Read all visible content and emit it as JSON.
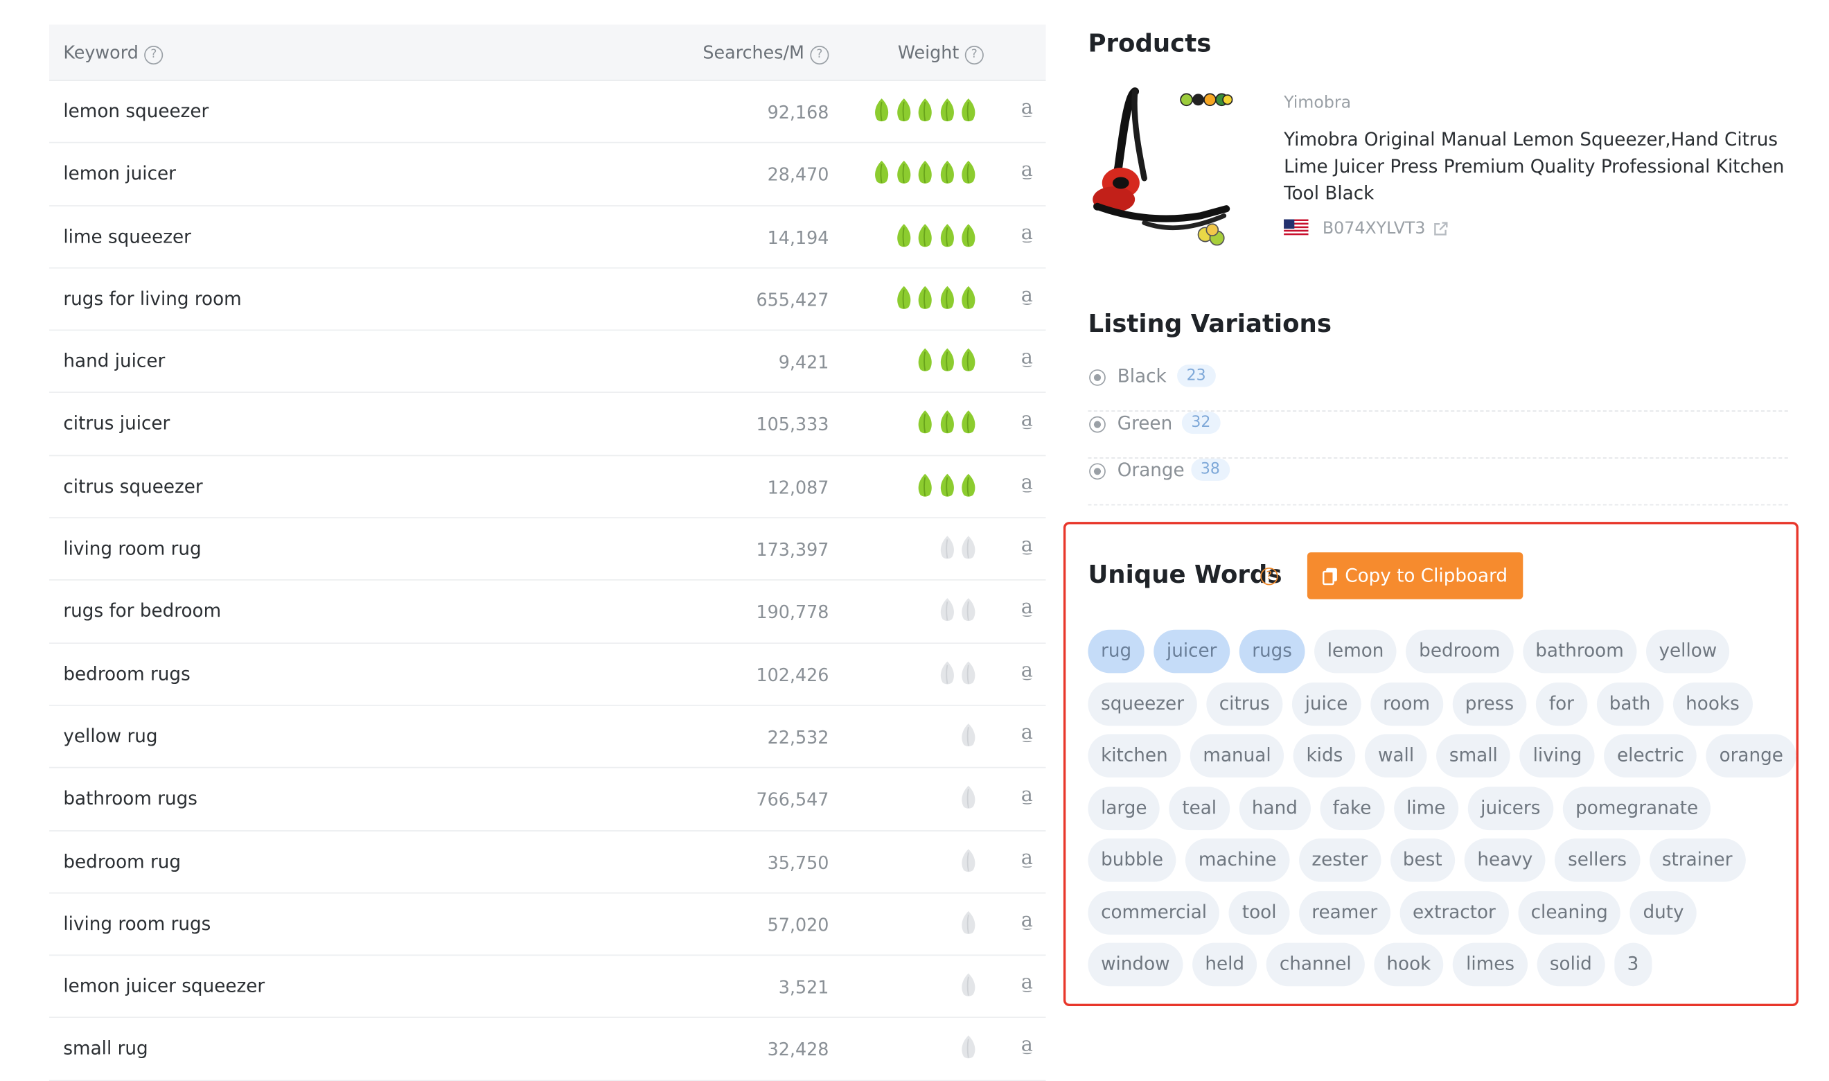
{
  "keyword_table": {
    "headers": {
      "keyword": "Keyword",
      "searches": "Searches/M",
      "weight": "Weight"
    },
    "rows": [
      {
        "keyword": "lemon squeezer",
        "searches": "92,168",
        "weight": 5,
        "weight_level": "high"
      },
      {
        "keyword": "lemon juicer",
        "searches": "28,470",
        "weight": 5,
        "weight_level": "high"
      },
      {
        "keyword": "lime squeezer",
        "searches": "14,194",
        "weight": 4,
        "weight_level": "high"
      },
      {
        "keyword": "rugs for living room",
        "searches": "655,427",
        "weight": 4,
        "weight_level": "high"
      },
      {
        "keyword": "hand juicer",
        "searches": "9,421",
        "weight": 3,
        "weight_level": "high"
      },
      {
        "keyword": "citrus juicer",
        "searches": "105,333",
        "weight": 3,
        "weight_level": "high"
      },
      {
        "keyword": "citrus squeezer",
        "searches": "12,087",
        "weight": 3,
        "weight_level": "high"
      },
      {
        "keyword": "living room rug",
        "searches": "173,397",
        "weight": 2,
        "weight_level": "low"
      },
      {
        "keyword": "rugs for bedroom",
        "searches": "190,778",
        "weight": 2,
        "weight_level": "low"
      },
      {
        "keyword": "bedroom rugs",
        "searches": "102,426",
        "weight": 2,
        "weight_level": "low"
      },
      {
        "keyword": "yellow rug",
        "searches": "22,532",
        "weight": 1,
        "weight_level": "low"
      },
      {
        "keyword": "bathroom rugs",
        "searches": "766,547",
        "weight": 1,
        "weight_level": "low"
      },
      {
        "keyword": "bedroom rug",
        "searches": "35,750",
        "weight": 1,
        "weight_level": "low"
      },
      {
        "keyword": "living room rugs",
        "searches": "57,020",
        "weight": 1,
        "weight_level": "low"
      },
      {
        "keyword": "lemon juicer squeezer",
        "searches": "3,521",
        "weight": 1,
        "weight_level": "low"
      },
      {
        "keyword": "small rug",
        "searches": "32,428",
        "weight": 1,
        "weight_level": "low"
      }
    ],
    "row_icon": "amazon-icon"
  },
  "products": {
    "title": "Products",
    "brand": "Yimobra",
    "product_title": "Yimobra Original Manual Lemon Squeezer,Hand Citrus Lime Juicer Press Premium Quality Professional Kitchen Tool Black",
    "asin": "B074XYLVT3",
    "flag_icon": "us-flag-icon",
    "link_icon": "external-link-icon"
  },
  "listing_variations": {
    "title": "Listing Variations",
    "items": [
      {
        "name": "Black",
        "count": "23"
      },
      {
        "name": "Green",
        "count": "32"
      },
      {
        "name": "Orange",
        "count": "38"
      }
    ]
  },
  "unique_words": {
    "title": "Unique Words",
    "help_icon": "question-icon",
    "copy_label": "Copy to Clipboard",
    "copy_icon": "clipboard-icon",
    "highlight_color": "#c5dcf8",
    "outline_color": "#e8372b",
    "button_color": "#f68b2e",
    "lines": [
      [
        {
          "w": "rug",
          "a": true
        },
        {
          "w": "juicer",
          "a": true
        },
        {
          "w": "rugs",
          "a": true
        },
        {
          "w": "lemon"
        },
        {
          "w": "bedroom"
        },
        {
          "w": "bathroom"
        },
        {
          "w": "yellow"
        }
      ],
      [
        {
          "w": "squeezer"
        },
        {
          "w": "citrus"
        },
        {
          "w": "juice"
        },
        {
          "w": "room"
        },
        {
          "w": "press"
        },
        {
          "w": "for"
        },
        {
          "w": "bath"
        },
        {
          "w": "hooks"
        }
      ],
      [
        {
          "w": "kitchen"
        },
        {
          "w": "manual"
        },
        {
          "w": "kids"
        },
        {
          "w": "wall"
        },
        {
          "w": "small"
        },
        {
          "w": "living"
        },
        {
          "w": "electric"
        },
        {
          "w": "orange"
        }
      ],
      [
        {
          "w": "large"
        },
        {
          "w": "teal"
        },
        {
          "w": "hand"
        },
        {
          "w": "fake"
        },
        {
          "w": "lime"
        },
        {
          "w": "juicers"
        },
        {
          "w": "pomegranate"
        }
      ],
      [
        {
          "w": "bubble"
        },
        {
          "w": "machine"
        },
        {
          "w": "zester"
        },
        {
          "w": "best"
        },
        {
          "w": "heavy"
        },
        {
          "w": "sellers"
        },
        {
          "w": "strainer"
        }
      ],
      [
        {
          "w": "commercial"
        },
        {
          "w": "tool"
        },
        {
          "w": "reamer"
        },
        {
          "w": "extractor"
        },
        {
          "w": "cleaning"
        },
        {
          "w": "duty"
        }
      ],
      [
        {
          "w": "window"
        },
        {
          "w": "held"
        },
        {
          "w": "channel"
        },
        {
          "w": "hook"
        },
        {
          "w": "limes"
        },
        {
          "w": "solid"
        },
        {
          "w": "3"
        }
      ]
    ]
  }
}
